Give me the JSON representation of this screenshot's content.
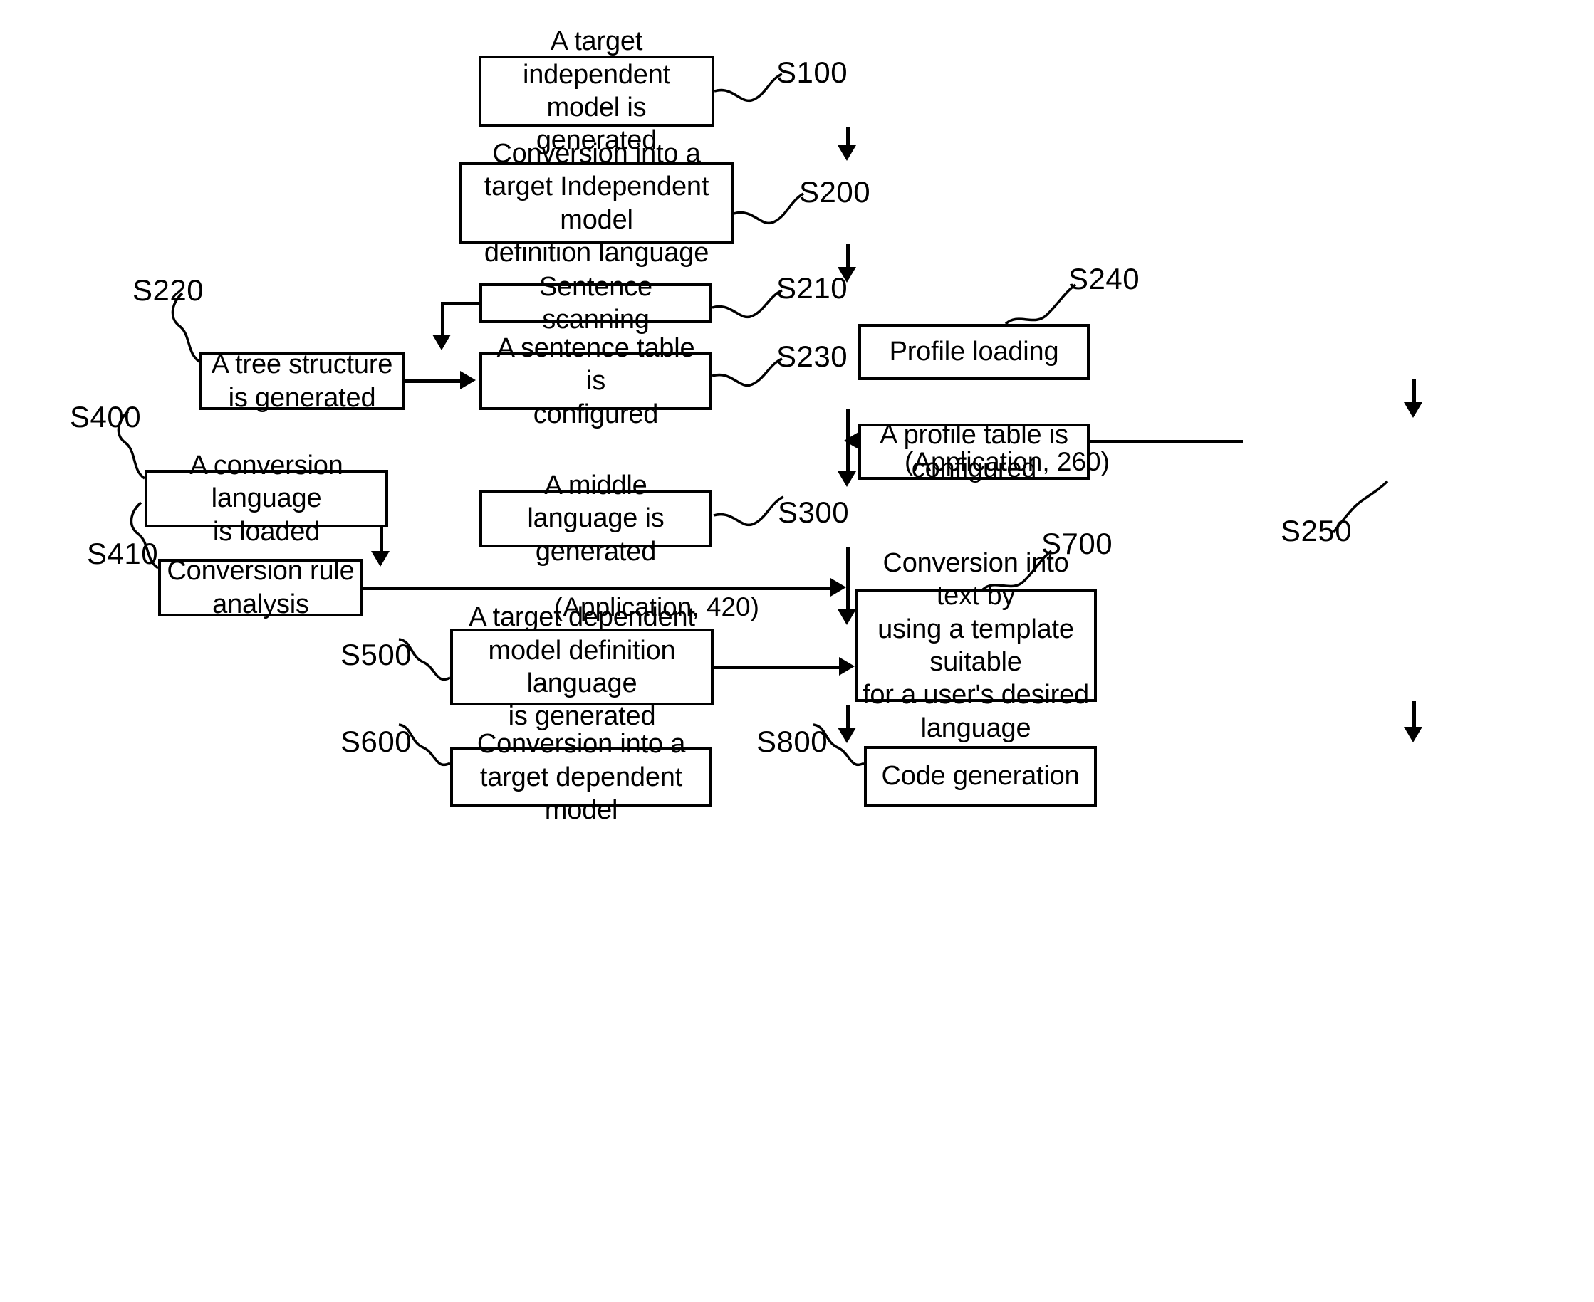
{
  "figure": {
    "type": "flowchart",
    "orientation": "top-to-bottom",
    "line_color": "#000000",
    "box_fill": "#ffffff"
  },
  "nodes": [
    {
      "id": "S100",
      "label": "A target independent\nmodel is generated"
    },
    {
      "id": "S200",
      "label": "Conversion into a\ntarget Independent model\ndefinition language"
    },
    {
      "id": "S210",
      "label": "Sentence scanning"
    },
    {
      "id": "S220",
      "label": "A tree structure\nis generated"
    },
    {
      "id": "S230",
      "label": "A sentence table is\nconfigured"
    },
    {
      "id": "S240",
      "label": "Profile loading"
    },
    {
      "id": "S250",
      "label": "A profile table is\nconfigured"
    },
    {
      "id": "S300",
      "label": "A middle language is\ngenerated"
    },
    {
      "id": "S400",
      "label": "A conversion language\nis loaded"
    },
    {
      "id": "S410",
      "label": "Conversion rule\nanalysis"
    },
    {
      "id": "S500",
      "label": "A target dependent\nmodel definition language\nis generated"
    },
    {
      "id": "S600",
      "label": "Conversion into a\ntarget dependent model"
    },
    {
      "id": "S700",
      "label": "Conversion into text by\nusing a template suitable\nfor a user's desired\nlanguage"
    },
    {
      "id": "S800",
      "label": "Code generation"
    }
  ],
  "reference_numerals": [
    {
      "id": "ref-s100",
      "text": "S100"
    },
    {
      "id": "ref-s200",
      "text": "S200"
    },
    {
      "id": "ref-s210",
      "text": "S210"
    },
    {
      "id": "ref-s220",
      "text": "S220"
    },
    {
      "id": "ref-s230",
      "text": "S230"
    },
    {
      "id": "ref-s240",
      "text": "S240"
    },
    {
      "id": "ref-s250",
      "text": "S250"
    },
    {
      "id": "ref-s300",
      "text": "S300"
    },
    {
      "id": "ref-s400",
      "text": "S400"
    },
    {
      "id": "ref-s410",
      "text": "S410"
    },
    {
      "id": "ref-s500",
      "text": "S500"
    },
    {
      "id": "ref-s600",
      "text": "S600"
    },
    {
      "id": "ref-s700",
      "text": "S700"
    },
    {
      "id": "ref-s800",
      "text": "S800"
    }
  ],
  "edge_labels": [
    {
      "id": "app260",
      "text": "(Application, 260)"
    },
    {
      "id": "app420",
      "text": "(Application, 420)"
    }
  ],
  "edges": [
    {
      "from": "S100",
      "to": "S200",
      "arrow": "down"
    },
    {
      "from": "S200",
      "to": "S210",
      "arrow": "down"
    },
    {
      "from": "S210",
      "to": "S220",
      "arrow": "down-left"
    },
    {
      "from": "S220",
      "to": "S230",
      "arrow": "right"
    },
    {
      "from": "S230",
      "to": "S300",
      "arrow": "down"
    },
    {
      "from": "S240",
      "to": "S250",
      "arrow": "down"
    },
    {
      "from": "S250",
      "to": "S300",
      "arrow": "left",
      "label": "(Application, 260)"
    },
    {
      "from": "S400",
      "to": "S410",
      "arrow": "down"
    },
    {
      "from": "S410",
      "to": "S500",
      "arrow": "right",
      "label": "(Application, 420)"
    },
    {
      "from": "S300",
      "to": "S500",
      "arrow": "down"
    },
    {
      "from": "S500",
      "to": "S600",
      "arrow": "down"
    },
    {
      "from": "S500",
      "to": "S700",
      "arrow": "right"
    },
    {
      "from": "S700",
      "to": "S800",
      "arrow": "down"
    }
  ]
}
